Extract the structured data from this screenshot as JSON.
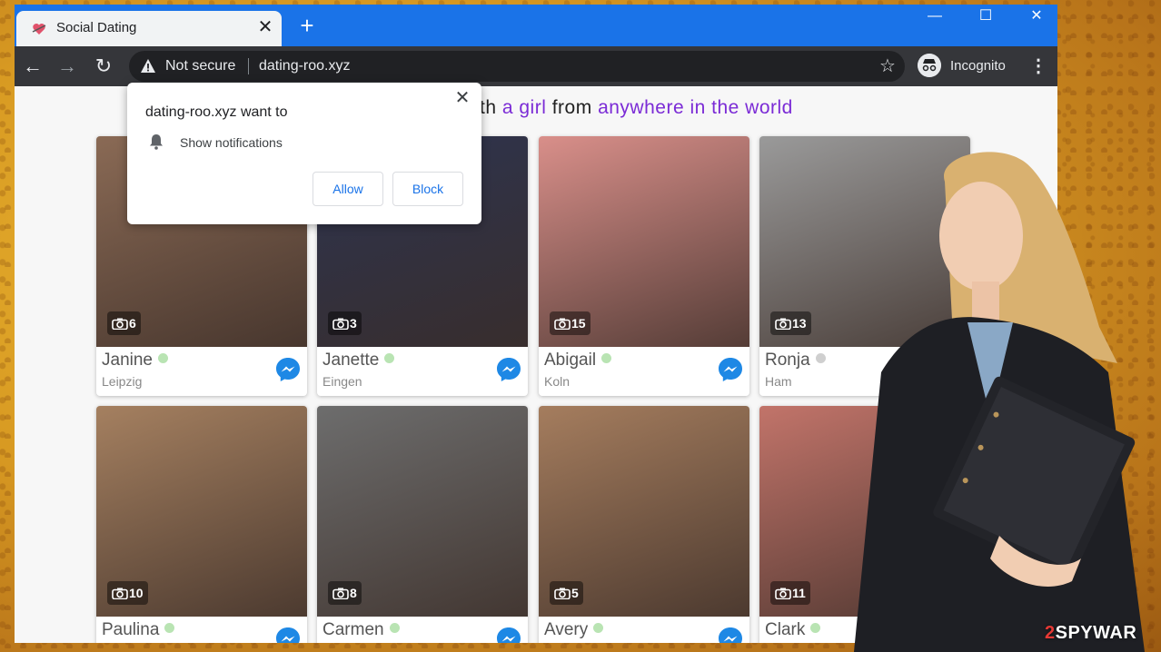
{
  "browser": {
    "tab_title": "Social Dating",
    "security_label": "Not secure",
    "url": "dating-roo.xyz",
    "incognito_label": "Incognito"
  },
  "headline": {
    "prefix": "th ",
    "accent1": "a girl",
    "middle": " from ",
    "accent2": "anywhere in the world"
  },
  "popup": {
    "title": "dating-roo.xyz want to",
    "permission": "Show notifications",
    "allow_label": "Allow",
    "block_label": "Block"
  },
  "profiles": [
    {
      "name": "Janine",
      "city": "Leipzig",
      "photos": "6",
      "online": true,
      "bg": "#8a6a55"
    },
    {
      "name": "Janette",
      "city": "Eingen",
      "photos": "3",
      "online": true,
      "bg": "#2d3450"
    },
    {
      "name": "Abigail",
      "city": "Koln",
      "photos": "15",
      "online": true,
      "bg": "#d98f8a"
    },
    {
      "name": "Ronja",
      "city": "Ham",
      "photos": "13",
      "online": false,
      "bg": "#9a9a9a"
    },
    {
      "name": "Paulina",
      "city": "",
      "photos": "10",
      "online": true,
      "bg": "#a58060"
    },
    {
      "name": "Carmen",
      "city": "",
      "photos": "8",
      "online": true,
      "bg": "#6d6d6d"
    },
    {
      "name": "Avery",
      "city": "",
      "photos": "5",
      "online": true,
      "bg": "#a57d5e"
    },
    {
      "name": "Clark",
      "city": "",
      "photos": "11",
      "online": true,
      "bg": "#c2746a"
    }
  ],
  "watermark": {
    "red": "2",
    "white": "SPYWAR"
  },
  "colors": {
    "tabstrip": "#1a73e8",
    "toolbar": "#35363a",
    "accent": "#7b2bd6",
    "messenger": "#1e88e5"
  }
}
